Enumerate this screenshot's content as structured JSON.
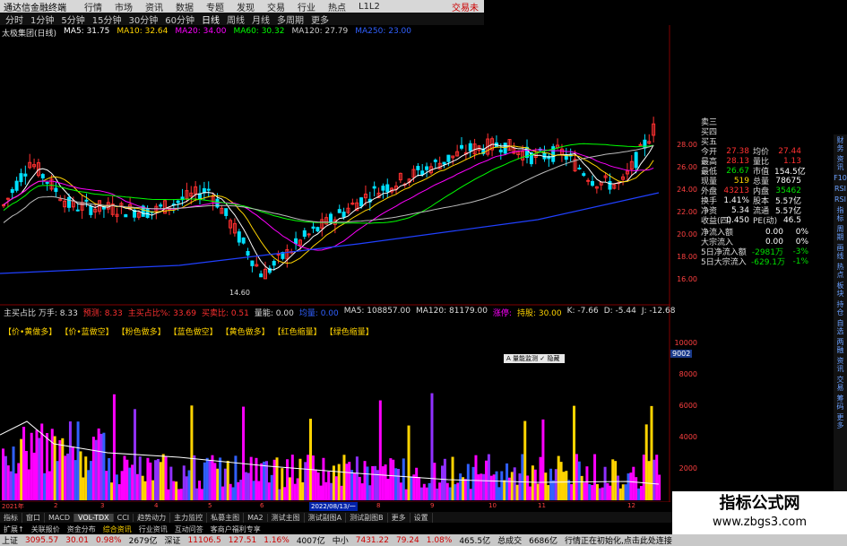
{
  "menubar": {
    "title": "通达信金融终端",
    "items": [
      "行情",
      "市场",
      "资讯",
      "数据",
      "专题",
      "发现",
      "交易",
      "行业",
      "热点",
      "L1L2"
    ],
    "right": "交易未"
  },
  "periods": [
    "分时",
    "1分钟",
    "5分钟",
    "15分钟",
    "30分钟",
    "60分钟",
    "日线",
    "周线",
    "月线",
    "多周期",
    "更多"
  ],
  "active_period": "日线",
  "ma_legend": {
    "stock": "太极集团(日线)",
    "ma5": "MA5: 31.75",
    "ma10": "MA10: 32.64",
    "ma20": "MA20: 34.00",
    "ma60": "MA60: 30.32",
    "ma120": "MA120: 27.79",
    "ma250": "MA250: 23.00"
  },
  "price_axis": [
    "28.00",
    "26.00",
    "24.00",
    "22.00",
    "20.00",
    "18.00",
    "16.00"
  ],
  "low_label": "14.60",
  "quote": {
    "top": [
      "卖三",
      "买四",
      "买五"
    ],
    "rows": [
      [
        "今开",
        "27.38",
        "均价",
        "27.44"
      ],
      [
        "最高",
        "28.13",
        "量比",
        "1.13"
      ],
      [
        "最低",
        "26.67",
        "市值",
        "154.5亿"
      ],
      [
        "现量",
        "519",
        "总量",
        "78675"
      ],
      [
        "外盘",
        "43213",
        "内盘",
        "35462"
      ],
      [
        "换手",
        "1.41%",
        "股本",
        "5.57亿"
      ],
      [
        "净资",
        "5.34",
        "流通",
        "5.57亿"
      ],
      [
        "收益(四)",
        "0.450",
        "PE(动)",
        "46.5"
      ]
    ],
    "flows": [
      [
        "净流入额",
        "0.00",
        "0%"
      ],
      [
        "大宗流入",
        "0.00",
        "0%"
      ],
      [
        "5日净流入额",
        "-2981万",
        "-3%"
      ],
      [
        "5日大宗流入",
        "-629.1万",
        "-1%"
      ]
    ]
  },
  "rightbar": [
    "财务",
    "资讯",
    "F10",
    "RSI",
    "RSI",
    "指标",
    "周期",
    "画线",
    "热点",
    "板块",
    "持仓",
    "自选",
    "两融",
    "资讯",
    "交易",
    "筹码",
    "更多"
  ],
  "indicator_legend": [
    "主买占比 万手: 8.33",
    "预测: 8.33",
    "主买占比%: 33.69",
    "买卖比: 0.51",
    "量能: 0.00",
    "均量: 0.00",
    "MA5: 108857.00",
    "MA120: 81179.00",
    "涨停: ",
    "持股: 30.00",
    "K: -7.66",
    "D: -5.44",
    "J: -12.68"
  ],
  "tags": [
    "【价•黄做多】",
    "【价•蓝做空】",
    "【粉色做多】",
    "【蓝色做空】",
    "【黄色做多】",
    "【红色缩量】",
    "【绿色缩量】"
  ],
  "tooltip": "A 量能监测 ✓ 隐藏",
  "vol_axis": [
    "10000",
    "8000",
    "6000",
    "4000",
    "2000"
  ],
  "cursor_val": "9002",
  "date_axis": [
    "2021年",
    "2",
    "3",
    "4",
    "5",
    "6",
    "7",
    "8",
    "9",
    "10",
    "11",
    "12"
  ],
  "cursor_date": "2022/08/13/一",
  "tabs": [
    "指标",
    "窗口",
    "MACD",
    "VOL-TDX",
    "CCI",
    "趋势动力",
    "主力监控",
    "私募主图",
    "MA2",
    "测试主图",
    "测试副图A",
    "测试副图B",
    "更多",
    "设置"
  ],
  "active_tab": "VOL-TDX",
  "subtabs": [
    "扩展↑",
    "关联报价",
    "资金分布",
    "综合资讯",
    "行业资讯",
    "互动问答",
    "客商户福利专享"
  ],
  "statusbar": [
    {
      "t": "上证",
      "c": ""
    },
    {
      "t": "3095.57",
      "c": "r"
    },
    {
      "t": "30.01",
      "c": "r"
    },
    {
      "t": "0.98%",
      "c": "r"
    },
    {
      "t": "2679亿",
      "c": ""
    },
    {
      "t": "深证",
      "c": ""
    },
    {
      "t": "11106.5",
      "c": "r"
    },
    {
      "t": "127.51",
      "c": "r"
    },
    {
      "t": "1.16%",
      "c": "r"
    },
    {
      "t": "4007亿",
      "c": ""
    },
    {
      "t": "中小",
      "c": ""
    },
    {
      "t": "7431.22",
      "c": "r"
    },
    {
      "t": "79.24",
      "c": "r"
    },
    {
      "t": "1.08%",
      "c": "r"
    },
    {
      "t": "465.5亿",
      "c": ""
    },
    {
      "t": "总成交",
      "c": ""
    },
    {
      "t": "6686亿",
      "c": ""
    },
    {
      "t": "行情正在初始化,点击此处连接",
      "c": ""
    }
  ],
  "watermark": {
    "line1": "指标公式网",
    "line2": "www.zbgs3.com"
  }
}
